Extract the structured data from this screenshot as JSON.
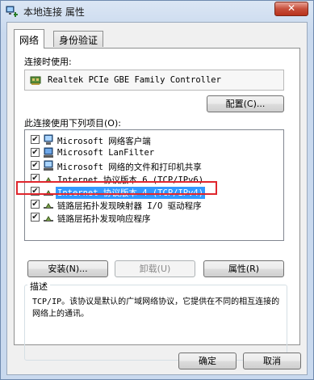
{
  "window": {
    "title": "本地连接 属性",
    "close_symbol": "✕"
  },
  "tabs": [
    {
      "label": "网络",
      "active": true
    },
    {
      "label": "身份验证",
      "active": false
    }
  ],
  "connect_using": {
    "label": "连接时使用:",
    "adapter_name": "Realtek PCIe GBE Family Controller",
    "configure_button": "配置(C)..."
  },
  "items_section": {
    "label": "此连接使用下列项目(O):",
    "items": [
      {
        "label": "Microsoft 网络客户端",
        "checked": true,
        "icon": "network-client-icon"
      },
      {
        "label": "Microsoft LanFilter",
        "checked": true,
        "icon": "service-icon"
      },
      {
        "label": "Microsoft 网络的文件和打印机共享",
        "checked": true,
        "icon": "file-printer-sharing-icon"
      },
      {
        "label": "Internet 协议版本 6 (TCP/IPv6)",
        "checked": true,
        "icon": "protocol-icon"
      },
      {
        "label": "Internet 协议版本 4 (TCP/IPv4)",
        "checked": true,
        "icon": "protocol-icon",
        "selected": true
      },
      {
        "label": "链路层拓扑发现映射器 I/O 驱动程序",
        "checked": true,
        "icon": "protocol-icon"
      },
      {
        "label": "链路层拓扑发现响应程序",
        "checked": true,
        "icon": "protocol-icon"
      }
    ],
    "check_mark": "✔"
  },
  "actions": {
    "install": "安装(N)...",
    "uninstall": "卸载(U)",
    "properties": "属性(R)"
  },
  "description": {
    "title": "描述",
    "text": "TCP/IP。该协议是默认的广域网络协议，它提供在不同的相互连接的网络上的通讯。"
  },
  "footer": {
    "ok": "确定",
    "cancel": "取消"
  },
  "colors": {
    "selection": "#3399ff",
    "annotation_box": "#e0262d",
    "close_button": "#c74f3b"
  }
}
